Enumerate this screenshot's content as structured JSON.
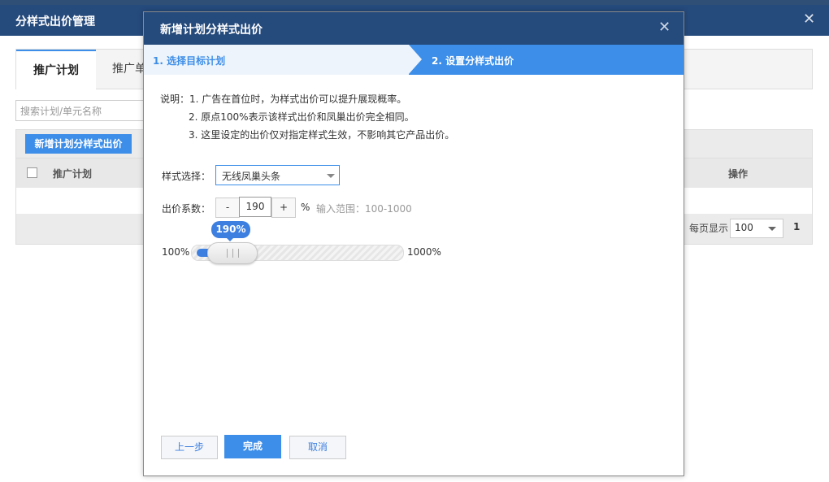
{
  "colors": {
    "header_bg": "#254a7c",
    "accent": "#3d8ee8",
    "slider": "#3d7fe0"
  },
  "background": {
    "title": "分样式出价管理",
    "tabs": [
      "推广计划",
      "推广单"
    ],
    "search_placeholder": "搜索计划/单元名称",
    "add_button": "新增计划分样式出价",
    "columns": [
      "推广计划",
      "操作"
    ],
    "pager_label": "每页显示",
    "page_size": "100",
    "page_number": "1",
    "close_icon": "close-icon"
  },
  "modal": {
    "title": "新增计划分样式出价",
    "close_icon": "close-icon",
    "steps": [
      "1. 选择目标计划",
      "2. 设置分样式出价"
    ],
    "active_step": 2,
    "notes": [
      "说明：1. 广告在首位时，为样式出价可以提升展现概率。",
      "2. 原点100%表示该样式出价和凤巢出价完全相同。",
      "3. 这里设定的出价仅对指定样式生效，不影响其它产品出价。"
    ],
    "style_label": "样式选择：",
    "style_value": "无线凤巢头条",
    "coef_label": "出价系数：",
    "coef_minus": "-",
    "coef_value": "190",
    "coef_plus": "+",
    "coef_unit": "%",
    "coef_hint": "输入范围：100-1000",
    "slider": {
      "tooltip": "190%",
      "min_label": "100%",
      "max_label": "1000%",
      "value": 190,
      "min": 100,
      "max": 1000
    },
    "buttons": {
      "prev": "上一步",
      "done": "完成",
      "cancel": "取消"
    }
  }
}
